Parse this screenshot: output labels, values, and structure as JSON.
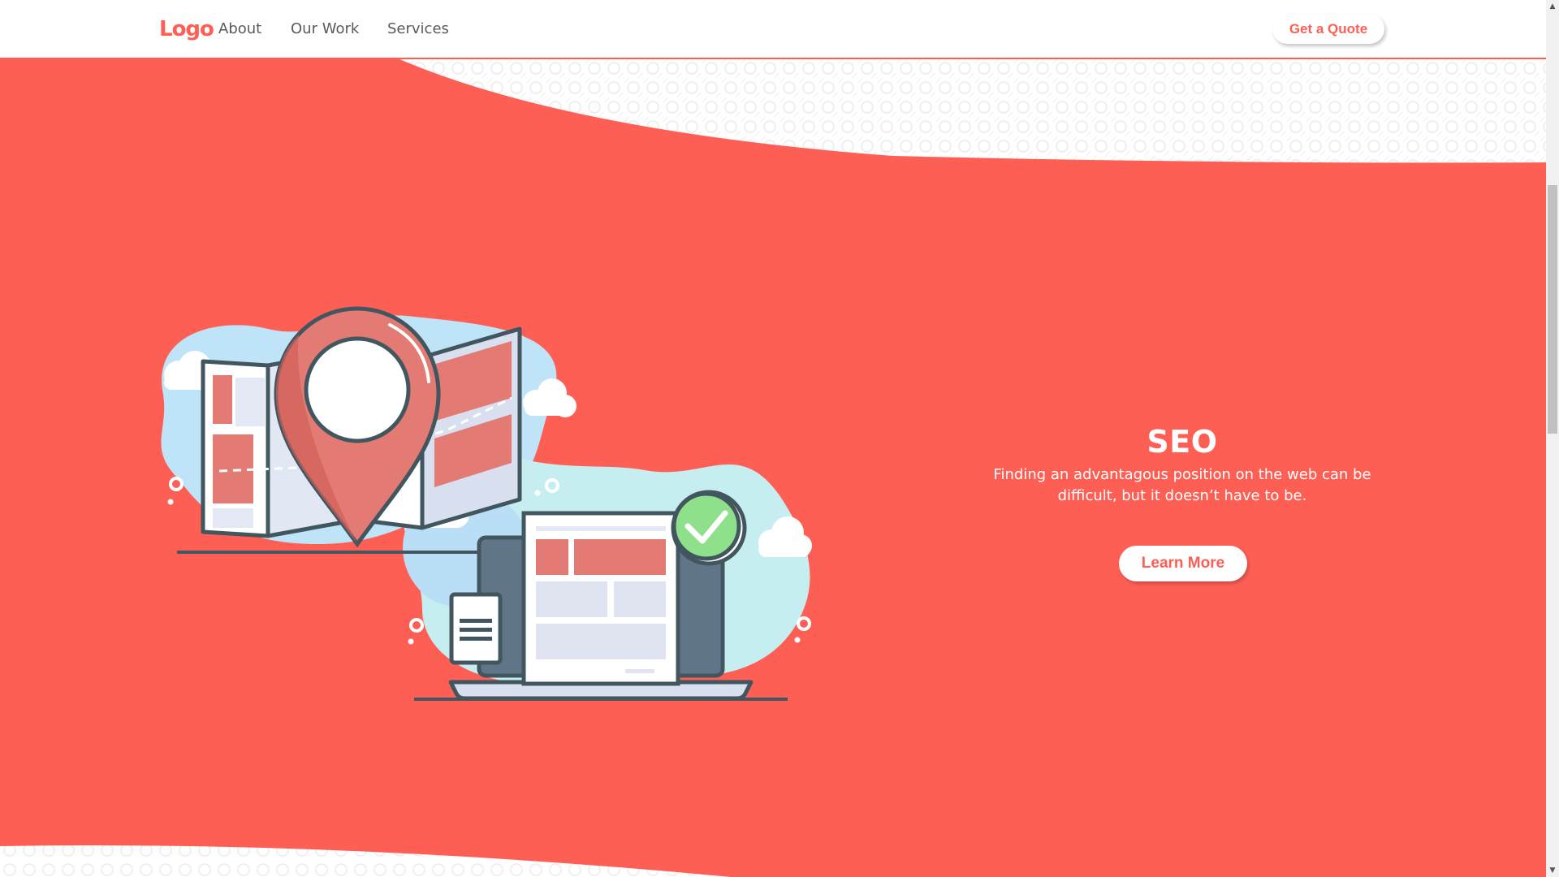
{
  "header": {
    "logo": "Logo",
    "nav": {
      "about": "About",
      "our_work": "Our Work",
      "services": "Services"
    },
    "cta_label": "Get a Quote"
  },
  "hero": {
    "title": "SEO",
    "description": "Finding an advantagous position on the web can be difficult, but it doesn’t have to be.",
    "button_label": "Learn More",
    "illustration_icons": [
      "folded-map-icon",
      "location-pin-icon",
      "laptop-icon",
      "web-page-icon",
      "checkmark-badge-icon",
      "document-icon",
      "cloud-icon"
    ]
  },
  "colors": {
    "brand": "#fe5f55",
    "text_on_brand": "#ffffff",
    "nav_text": "#5a5a5a"
  }
}
